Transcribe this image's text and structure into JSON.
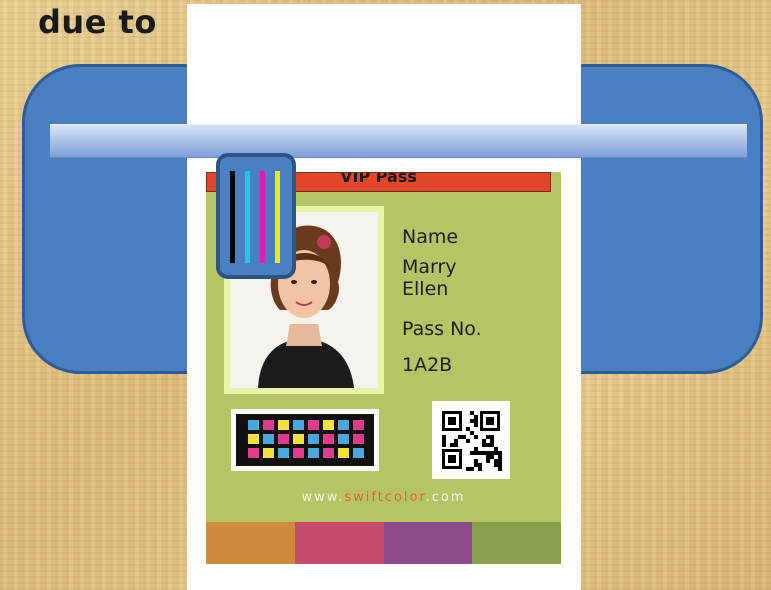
{
  "headline": "due to",
  "card": {
    "header_text": "VIP Pass",
    "name_label": "Name",
    "name_first": "Marry",
    "name_last": "Ellen",
    "pass_label": "Pass No.",
    "pass_value": "1A2B",
    "website_prefix": "www.",
    "website_brand": "swiftcolor",
    "website_suffix": ".com"
  },
  "colors": {
    "printer_body": "#4a7fc1",
    "card_background": "#b5c464",
    "header_red": "#e2472a",
    "ink": [
      "#000000",
      "#1ec8e8",
      "#e21cb8",
      "#f6e51a"
    ],
    "stripes": [
      "#d08a3c",
      "#c64c6e",
      "#8a4a8a",
      "#8aa04a"
    ]
  },
  "icons": {
    "printhead": "ink-cartridge-icon",
    "qr": "qr-code-icon",
    "chart": "color-chart-icon"
  }
}
